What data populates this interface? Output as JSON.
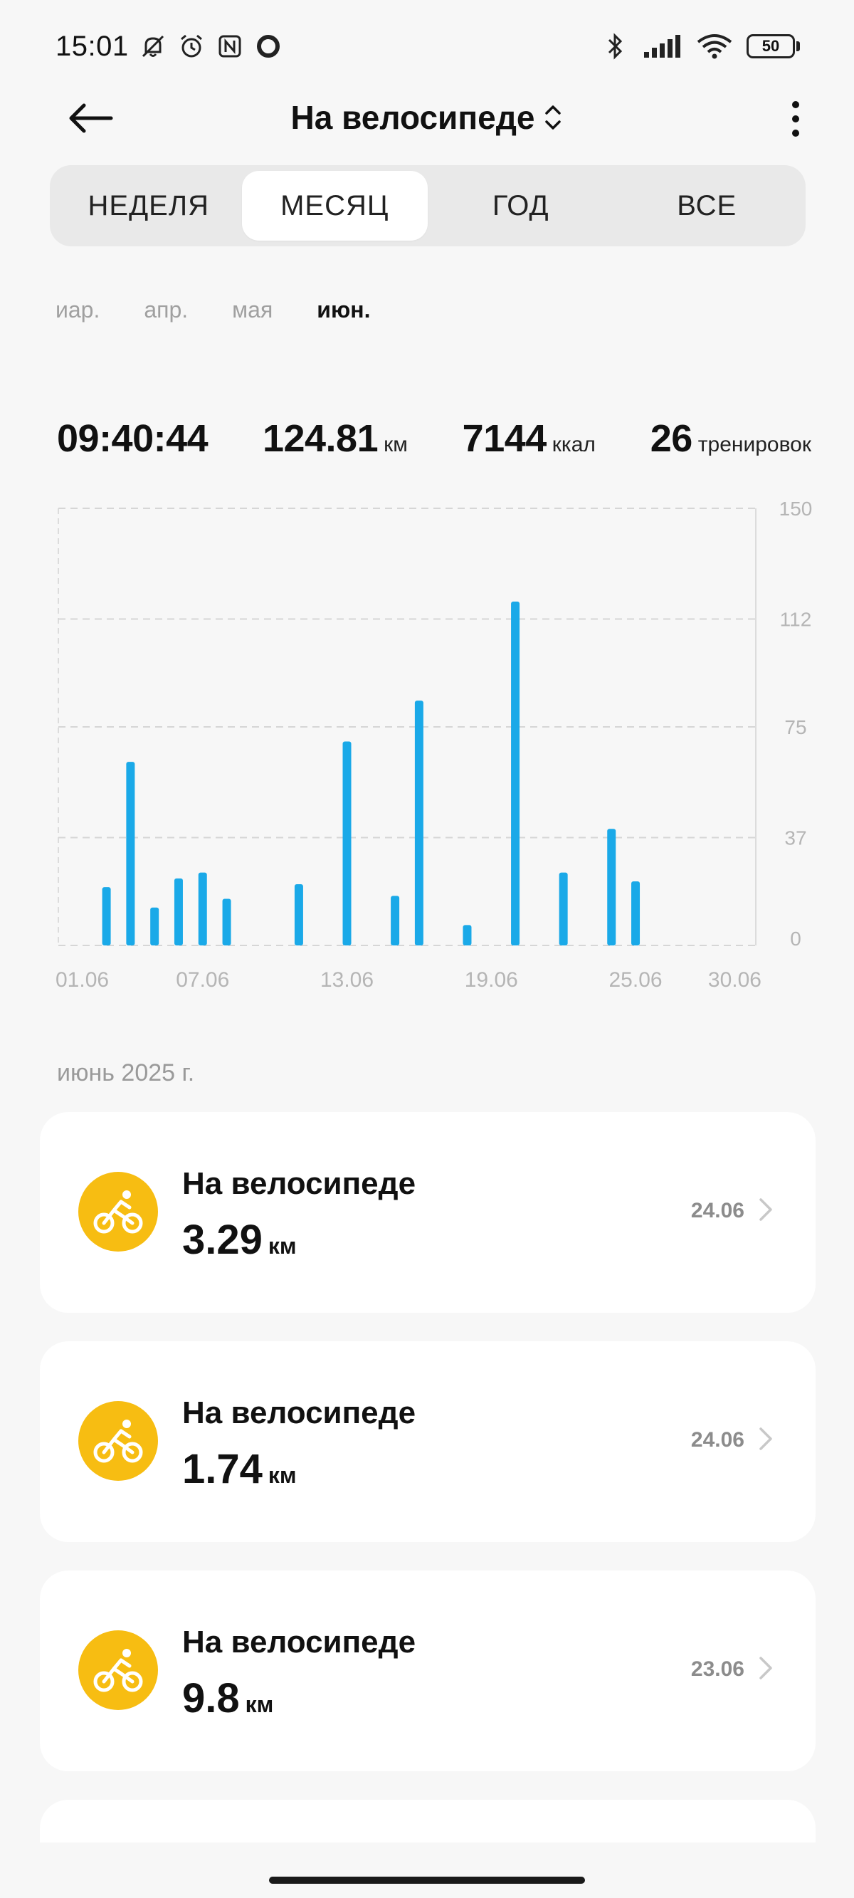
{
  "status_bar": {
    "time": "15:01",
    "battery": "50"
  },
  "app_bar": {
    "title": "На велосипеде"
  },
  "tabs": [
    {
      "label": "НЕДЕЛЯ",
      "active": false
    },
    {
      "label": "МЕСЯЦ",
      "active": true
    },
    {
      "label": "ГОД",
      "active": false
    },
    {
      "label": "ВСЕ",
      "active": false
    }
  ],
  "months": [
    {
      "label": "иар.",
      "active": false
    },
    {
      "label": "апр.",
      "active": false
    },
    {
      "label": "мая",
      "active": false
    },
    {
      "label": "июн.",
      "active": true
    }
  ],
  "summary": {
    "duration": "09:40:44",
    "distance": "124.81",
    "distance_unit": "км",
    "calories": "7144",
    "calories_unit": "ккал",
    "workouts": "26",
    "workouts_unit": "тренировок"
  },
  "chart_data": {
    "type": "bar",
    "x_tick_labels": [
      "01.06",
      "07.06",
      "13.06",
      "19.06",
      "25.06",
      "30.06"
    ],
    "y_tick_labels": [
      "150",
      "112",
      "75",
      "37",
      "0"
    ],
    "ylim": [
      0,
      150
    ],
    "grid": true,
    "color": "#1aa9e8",
    "x": [
      3,
      4,
      5,
      6,
      7,
      8,
      11,
      13,
      15,
      16,
      18,
      20,
      22,
      24,
      25
    ],
    "values": [
      20,
      63,
      13,
      23,
      25,
      16,
      21,
      70,
      17,
      84,
      7,
      118,
      25,
      40,
      22
    ]
  },
  "section": {
    "title": "июнь 2025 г."
  },
  "workouts": [
    {
      "title": "На велосипеде",
      "distance": "3.29",
      "unit": "км",
      "date": "24.06"
    },
    {
      "title": "На велосипеде",
      "distance": "1.74",
      "unit": "км",
      "date": "24.06"
    },
    {
      "title": "На велосипеде",
      "distance": "9.8",
      "unit": "км",
      "date": "23.06"
    }
  ],
  "colors": {
    "accent_bar": "#1aa9e8",
    "bike_icon_bg": "#f7bd12"
  }
}
